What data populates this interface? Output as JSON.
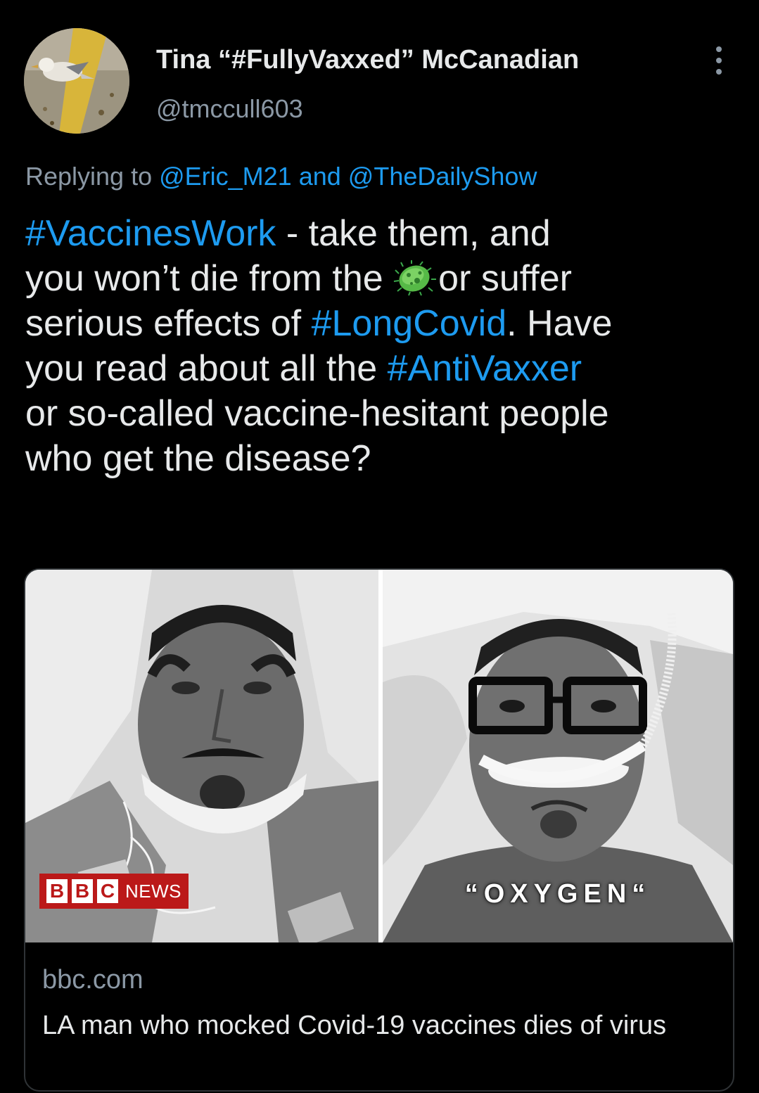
{
  "author": {
    "display_name": "Tina “#FullyVaxxed” McCanadian",
    "handle": "@tmccull603",
    "avatar_icon": "avatar-bird-photo"
  },
  "reply": {
    "prefix": "Replying to ",
    "mention1": "@Eric_M21",
    "joiner": " and ",
    "mention2": "@TheDailyShow"
  },
  "body": {
    "l1_tag": "#VaccinesWork",
    "l1_text": " - take them, and",
    "l2_text_a": "you won’t die from the ",
    "l2_emoji": "microbe-emoji",
    "l2_text_b": "or suffer",
    "l3_text_a": "serious effects of ",
    "l3_tag": "#LongCovid",
    "l3_text_b": ". Have",
    "l4_text_a": "you read about all the ",
    "l4_tag": "#AntiVaxxer",
    "l5_text": "or so-called vaccine-hesitant people",
    "l6_text": "who get the disease?"
  },
  "card": {
    "badge_letters": [
      "B",
      "B",
      "C"
    ],
    "badge_word": "NEWS",
    "right_caption": "“OXYGEN“",
    "domain": "bbc.com",
    "title": "LA man who mocked Covid-19 vaccines dies of virus"
  },
  "colors": {
    "background": "#000000",
    "text": "#e7e9ea",
    "secondary": "#8b98a5",
    "accent": "#1d9bf0",
    "border": "#2f3336",
    "bbc_red": "#bb1919"
  }
}
